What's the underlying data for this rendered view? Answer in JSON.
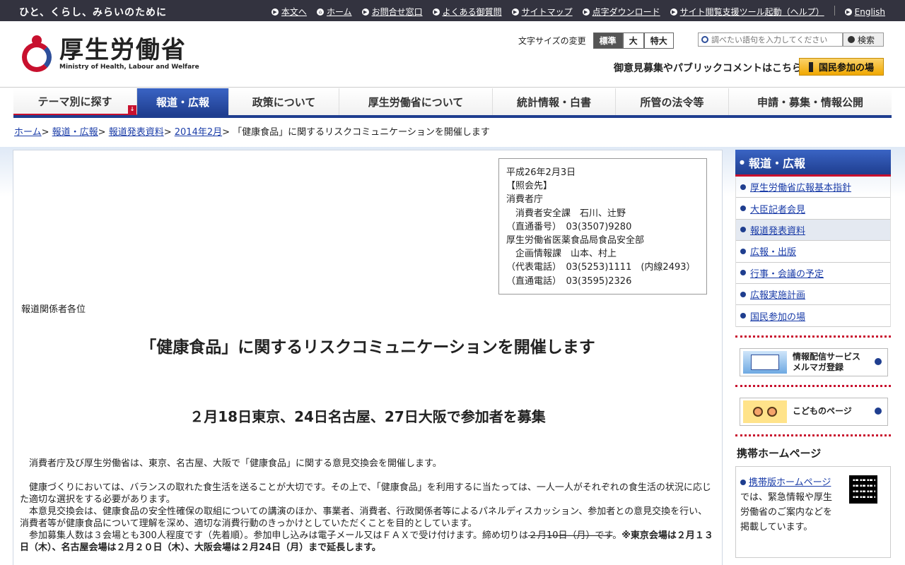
{
  "topbar": {
    "tagline": "ひと、くらし、みらいのために",
    "links": [
      "本文へ",
      "ホーム",
      "お問合せ窓口",
      "よくある御質問",
      "サイトマップ",
      "点字ダウンロード",
      "サイト閲覧支援ツール起動（ヘルプ）",
      "English"
    ]
  },
  "header": {
    "logo_jp": "厚生労働省",
    "logo_en": "Ministry of Health, Labour and Welfare",
    "fontsize_label": "文字サイズの変更",
    "fontsize_options": [
      "標準",
      "大",
      "特大"
    ],
    "search_placeholder": "調べたい語句を入力してください",
    "search_button": "検索",
    "public_comment": "御意見募集やパブリックコメントはこちら",
    "participation_button": "国民参加の場"
  },
  "gnav": [
    "テーマ別に探す",
    "報道・広報",
    "政策について",
    "厚生労働省について",
    "統計情報・白書",
    "所管の法令等",
    "申請・募集・情報公開"
  ],
  "breadcrumb": {
    "items": [
      "ホーム",
      "報道・広報",
      "報道発表資料",
      "2014年2月"
    ],
    "current": "「健康食品」に関するリスクコミュニケーションを開催します"
  },
  "contact": "平成26年2月3日\n【照会先】\n消費者庁\n　消費者安全課　石川、辻野\n（直通番号）　03(3507)9280\n厚生労働省医薬食品局食品安全部\n　企画情報課　山本、村上\n（代表電話）　03(5253)1111　(内線2493）\n（直通電話）　03(3595)2326",
  "addressee": "報道関係者各位",
  "title": "「健康食品」に関するリスクコミュニケーションを開催します",
  "subtitle": "２月18日東京、24日名古屋、27日大阪で参加者を募集",
  "body": {
    "p1": "消費者庁及び厚生労働省は、東京、名古屋、大阪で「健康食品」に関する意見交換会を開催します。",
    "p2": "健康づくりにおいては、バランスの取れた食生活を送ることが大切です。その上で、「健康食品」を利用するに当たっては、一人一人がそれぞれの食生活の状況に応じた適切な選択をする必要があります。",
    "p3": "本意見交換会は、健康食品の安全性確保の取組についての講演のほか、事業者、消費者、行政関係者等によるパネルディスカッション、参加者との意見交換を行い、消費者等が健康食品について理解を深め、適切な消費行動のきっかけとしていただくことを目的としています。",
    "p4_a": "参加募集人数は３会場とも300人程度です（先着順）。参加申し込みは電子メール又はＦＡＸで受け付けます。締め切りは",
    "p4_strike": "２月10日（月）です",
    "p4_b": "。",
    "p4_bold": "※東京会場は２月１３日（木）、名古屋会場は２月２０日（木）、大阪会場は２月24日（月）まで延長します。"
  },
  "sidebar": {
    "heading": "報道・広報",
    "items": [
      "厚生労働省広報基本指針",
      "大臣記者会見",
      "報道発表資料",
      "広報・出版",
      "行事・会議の予定",
      "広報実施計画",
      "国民参加の場"
    ],
    "mail_banner_l1": "情報配信サービス",
    "mail_banner_l2": "メルマガ登録",
    "kids_banner": "こどものページ",
    "mobile_heading": "携帯ホームページ",
    "mobile_link": "携帯版ホームページ",
    "mobile_text": "では、緊急情報や厚生労働省のご案内などを掲載しています。"
  }
}
